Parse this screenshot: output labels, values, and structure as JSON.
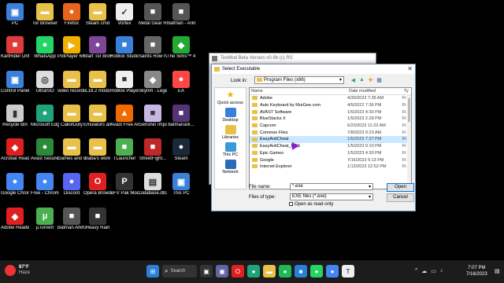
{
  "desktop": {
    "icons": [
      {
        "label": "PC",
        "color": "#3a7fd8",
        "glyph": "▣"
      },
      {
        "label": "Tor Browser",
        "color": "#e8c14a",
        "glyph": "▬"
      },
      {
        "label": "Firefox",
        "color": "#e8641c",
        "glyph": "●"
      },
      {
        "label": "Steam cmd",
        "color": "#e8c14a",
        "glyph": "▬"
      },
      {
        "label": "Vortex",
        "color": "#eeeeee",
        "glyph": "✓"
      },
      {
        "label": "Metal Gear Rising Reve...",
        "color": "#555555",
        "glyph": "■"
      },
      {
        "label": "Batman - Arkha...",
        "color": "#555555",
        "glyph": "■"
      },
      {
        "label": "KartRider Drift",
        "color": "#e03a3a",
        "glyph": "■"
      },
      {
        "label": "WhatsApp",
        "color": "#25d366",
        "glyph": "●"
      },
      {
        "label": "PotPlayer 64 bit",
        "color": "#f0b000",
        "glyph": "▶"
      },
      {
        "label": "Start Tor Browser",
        "color": "#7d4698",
        "glyph": "●"
      },
      {
        "label": "Roblox Studio",
        "color": "#3a7fd8",
        "glyph": "■"
      },
      {
        "label": "Saints Row IV",
        "color": "#666666",
        "glyph": "■"
      },
      {
        "label": "The Sims™ 4",
        "color": "#22aa33",
        "glyph": "◆"
      },
      {
        "label": "Control Panel",
        "color": "#3a7fd8",
        "glyph": "▣"
      },
      {
        "label": "UltraISO",
        "color": "#dddddd",
        "glyph": "◎"
      },
      {
        "label": "video recording...",
        "color": "#e8c14a",
        "glyph": "▬"
      },
      {
        "label": "L18.2 mods",
        "color": "#e8c14a",
        "glyph": "▬"
      },
      {
        "label": "Roblox Player",
        "color": "#eeeeee",
        "glyph": "■"
      },
      {
        "label": "Skyrim - Legenda...",
        "color": "#888888",
        "glyph": "◆"
      },
      {
        "label": "EA",
        "color": "#ff4747",
        "glyph": "●"
      },
      {
        "label": "Recycle Bin",
        "color": "#cccccc",
        "glyph": "▮"
      },
      {
        "label": "Microsoft Edge",
        "color": "#1fa37a",
        "glyph": "●"
      },
      {
        "label": "CallofDuty",
        "color": "#e8c14a",
        "glyph": "▬"
      },
      {
        "label": "Emulators and games",
        "color": "#e8c14a",
        "glyph": "▬"
      },
      {
        "label": "Avast Free Antivirus",
        "color": "#f06a00",
        "glyph": "▲"
      },
      {
        "label": "Genshin Impact",
        "color": "#c8b6e2",
        "glyph": "■"
      },
      {
        "label": "batmanark...",
        "color": "#553377",
        "glyph": "■"
      },
      {
        "label": "Acrobat Reader",
        "color": "#e02020",
        "glyph": "◆"
      },
      {
        "label": "Avast Secure Browser",
        "color": "#2a8a3a",
        "glyph": "●"
      },
      {
        "label": "Games and launchers",
        "color": "#e8c14a",
        "glyph": "▬"
      },
      {
        "label": "Baba's work",
        "color": "#e8c14a",
        "glyph": "▬"
      },
      {
        "label": "TLauncher",
        "color": "#4caf50",
        "glyph": "■"
      },
      {
        "label": "StreetFight...",
        "color": "#c02828",
        "glyph": "■"
      },
      {
        "label": "Steam",
        "color": "#1b2838",
        "glyph": "●"
      },
      {
        "label": "Google Chrome",
        "color": "#4285f4",
        "glyph": "●"
      },
      {
        "label": "Free - Chrome",
        "color": "#4285f4",
        "glyph": "●"
      },
      {
        "label": "Discord",
        "color": "#5865f2",
        "glyph": "●"
      },
      {
        "label": "Opera Browser",
        "color": "#e02020",
        "glyph": "O"
      },
      {
        "label": "SFV Pak Mod Manager",
        "color": "#333333",
        "glyph": "P"
      },
      {
        "label": "Database.db3",
        "color": "#dddddd",
        "glyph": "▤"
      },
      {
        "label": "This PC",
        "color": "#3a7fd8",
        "glyph": "▣"
      },
      {
        "label": "Adobe Reader XI",
        "color": "#e02020",
        "glyph": "◆"
      },
      {
        "label": "µTorrent",
        "color": "#4caf50",
        "glyph": "µ"
      },
      {
        "label": "Batman Arkham Ci...",
        "color": "#555555",
        "glyph": "■"
      },
      {
        "label": "Heavy Rain",
        "color": "#333333",
        "glyph": "■"
      }
    ]
  },
  "background_window": {
    "title": "TexMod Beta Version v0.9b (c) RS"
  },
  "dialog": {
    "title": "Select Executable",
    "close_glyph": "✕",
    "look_in_label": "Look in:",
    "look_in_value": "Program Files (x86)",
    "places": [
      "Quick access",
      "Desktop",
      "Libraries",
      "This PC",
      "Network"
    ],
    "columns": {
      "name": "Name",
      "date": "Date modified",
      "type": "Ty"
    },
    "files": [
      {
        "name": "Adobe",
        "date": "4/30/2023 7:35 AM",
        "type": "Fi"
      },
      {
        "name": "Auto Keyboard by MurGee.com",
        "date": "4/5/2022 7:36 PM",
        "type": "Fi"
      },
      {
        "name": "AVAST Software",
        "date": "1/5/2023 4:30 PM",
        "type": "Fi"
      },
      {
        "name": "BlueStacks X",
        "date": "1/5/2023 2:28 PM",
        "type": "Fi"
      },
      {
        "name": "Capcom",
        "date": "6/23/2023 11:23 AM",
        "type": "Fi"
      },
      {
        "name": "Common Files",
        "date": "7/8/2023 9:23 AM",
        "type": "Fi"
      },
      {
        "name": "EasyAntiCheat",
        "date": "1/5/2023 7:37 PM",
        "type": "Fi"
      },
      {
        "name": "EasyAntiCheat_EOS",
        "date": "1/5/2023 9:10 PM",
        "type": "Fi"
      },
      {
        "name": "Epic Games",
        "date": "1/5/2023 4:30 PM",
        "type": "Fi"
      },
      {
        "name": "Google",
        "date": "7/16/2023 5:13 PM",
        "type": "Fi"
      },
      {
        "name": "Internet Explorer",
        "date": "1/13/2023 12:52 PM",
        "type": "Fi"
      }
    ],
    "highlighted_index": 6,
    "file_name_label": "File name:",
    "file_name_value": "*.exe",
    "files_of_type_label": "Files of type:",
    "files_of_type_value": "EXE files (*.exe)",
    "read_only_label": "Open as read-only",
    "open_button": "Open",
    "cancel_button": "Cancel"
  },
  "taskbar": {
    "temperature": "87°F",
    "weather": "Haze",
    "search_label": "Search",
    "time": "7:07 PM",
    "date": "7/16/2023",
    "tray_glyphs": [
      "^",
      "☁",
      "▭",
      "♪"
    ],
    "notification_glyph": "▤",
    "apps": [
      {
        "name": "start",
        "color": "#2a7fd8",
        "glyph": "⊞"
      },
      {
        "name": "search",
        "color": "#333333",
        "glyph": "⌕"
      },
      {
        "name": "task-view",
        "color": "#333333",
        "glyph": "▣"
      },
      {
        "name": "chat",
        "color": "#6264a7",
        "glyph": "▣"
      },
      {
        "name": "opera",
        "color": "#e02020",
        "glyph": "O"
      },
      {
        "name": "edge",
        "color": "#1fa37a",
        "glyph": "●"
      },
      {
        "name": "file-explorer",
        "color": "#e8c14a",
        "glyph": "▬"
      },
      {
        "name": "spotify",
        "color": "#1db954",
        "glyph": "●"
      },
      {
        "name": "store",
        "color": "#2a7fd8",
        "glyph": "■"
      },
      {
        "name": "whatsapp",
        "color": "#25d366",
        "glyph": "●"
      },
      {
        "name": "chrome",
        "color": "#4285f4",
        "glyph": "●"
      },
      {
        "name": "texmod",
        "color": "#eeeeee",
        "glyph": "T"
      }
    ]
  }
}
